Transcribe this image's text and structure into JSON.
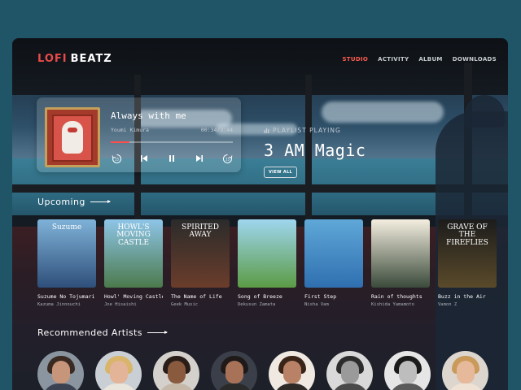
{
  "app": {
    "logo_part1": "LOFI",
    "logo_part2": "BEATZ"
  },
  "nav": {
    "items": [
      {
        "label": "STUDIO",
        "active": true
      },
      {
        "label": "ACTIVITY",
        "active": false
      },
      {
        "label": "ALBUM",
        "active": false
      },
      {
        "label": "DOWNLOADS",
        "active": false
      }
    ]
  },
  "player": {
    "title": "Always with me",
    "artist": "Youmi Kimura",
    "time": "00:34/3:44",
    "progress": 0.15
  },
  "playlist": {
    "label": "PLAYLIST PLAYING",
    "title": "3 AM Magic",
    "view_all": "VIEW ALL"
  },
  "sections": {
    "upcoming": "Upcoming",
    "recommended": "Recommended Artists"
  },
  "albums": [
    {
      "cover_text": "Suzume",
      "name": "Suzume No Tojumari",
      "artist": "Kazuma Jinnouchi",
      "color_top": "#7fb2d8",
      "color_bot": "#2e4f7a"
    },
    {
      "cover_text": "HOWL'S MOVING CASTLE",
      "name": "Howl' Moving Castle",
      "artist": "Joe Hisaishi",
      "color_top": "#8ec5e8",
      "color_bot": "#4b7a4c"
    },
    {
      "cover_text": "SPIRITED AWAY",
      "name": "The Name of Life",
      "artist": "Geek Music",
      "color_top": "#2b2b2b",
      "color_bot": "#6b3d2b"
    },
    {
      "cover_text": "",
      "name": "Song of Breeze",
      "artist": "Dekusun Zamata",
      "color_top": "#9fd6ef",
      "color_bot": "#5b9b45"
    },
    {
      "cover_text": "",
      "name": "First Step",
      "artist": "Nisha Vam",
      "color_top": "#5fa8d8",
      "color_bot": "#2f6fb0"
    },
    {
      "cover_text": "",
      "name": "Rain of thoughts",
      "artist": "Kishida Yamamoto",
      "color_top": "#f4eee0",
      "color_bot": "#3a4a3a"
    },
    {
      "cover_text": "GRAVE OF THE FIREFLIES",
      "name": "Buzz in the Air",
      "artist": "Vamon Z",
      "color_top": "#1c1c1c",
      "color_bot": "#5a4a2a"
    }
  ],
  "artists": [
    {
      "skin": "#c7957a",
      "hair": "#3a2a22",
      "shirt": "#3b4252",
      "bg": "#8a95a0"
    },
    {
      "skin": "#e3b497",
      "hair": "#d8b56a",
      "shirt": "#e9e4dc",
      "bg": "#c9cfd5"
    },
    {
      "skin": "#8a5a3e",
      "hair": "#2a1d18",
      "shirt": "#c6b8a8",
      "bg": "#d4d0cc"
    },
    {
      "skin": "#a87258",
      "hair": "#1f1a18",
      "shirt": "#2a2a2a",
      "bg": "#3a3f4a"
    },
    {
      "skin": "#b98266",
      "hair": "#3a2418",
      "shirt": "#2e2a28",
      "bg": "#efe9e2"
    },
    {
      "skin": "#9a9a9a",
      "hair": "#2c2c2c",
      "shirt": "#4a4a4a",
      "bg": "#d9d9d9"
    },
    {
      "skin": "#bdbdbd",
      "hair": "#1a1a1a",
      "shirt": "#5a5a5a",
      "bg": "#e6e6e6"
    },
    {
      "skin": "#e6b99a",
      "hair": "#c99a5a",
      "shirt": "#efe2d4",
      "bg": "#dcd6cf"
    }
  ]
}
